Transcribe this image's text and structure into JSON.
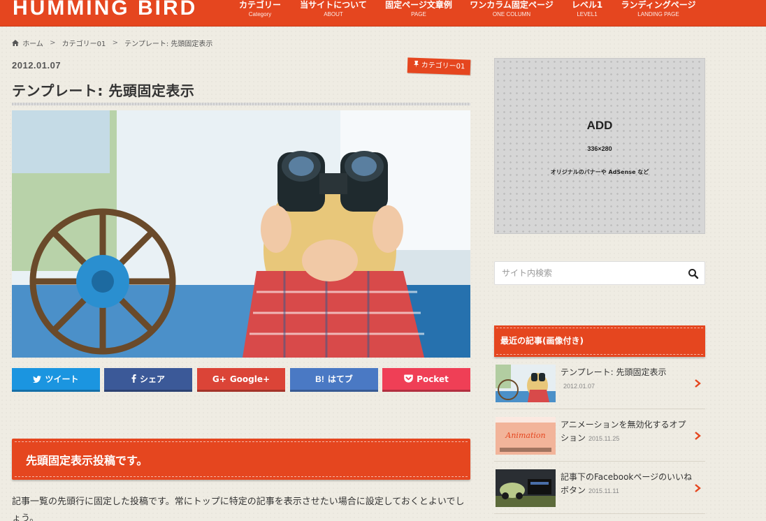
{
  "header": {
    "logo": "HUMMING BIRD",
    "nav": [
      {
        "jp": "カテゴリー",
        "en": "Category"
      },
      {
        "jp": "当サイトについて",
        "en": "ABOUT"
      },
      {
        "jp": "固定ページ文章例",
        "en": "PAGE"
      },
      {
        "jp": "ワンカラム固定ページ",
        "en": "ONE COLUMN"
      },
      {
        "jp": "レベル1",
        "en": "LEVEL1"
      },
      {
        "jp": "ランディングページ",
        "en": "LANDING PAGE"
      }
    ]
  },
  "breadcrumb": {
    "home": "ホーム",
    "sep": ">",
    "category": "カテゴリー01",
    "current": "テンプレート: 先頭固定表示"
  },
  "post": {
    "date": "2012.01.07",
    "category": "カテゴリー01",
    "title": "テンプレート: 先頭固定表示",
    "heading": "先頭固定表示投稿です。",
    "body": "記事一覧の先頭行に固定した投稿です。常にトップに特定の記事を表示させたい場合に設定しておくとよいでしょう。"
  },
  "share": [
    {
      "label": "ツイート",
      "color": "#1b95e0"
    },
    {
      "label": "シェア",
      "color": "#3b5998"
    },
    {
      "label": "Google+",
      "color": "#db4437"
    },
    {
      "label": "はてブ",
      "color": "#4a79c4"
    },
    {
      "label": "Pocket",
      "color": "#ef3f56"
    }
  ],
  "sidebar": {
    "ad": {
      "title": "ADD",
      "size": "336×280",
      "note": "オリジナルのバナーや AdSense など"
    },
    "search_placeholder": "サイト内検索",
    "recent_heading": "最近の記事(画像付き)",
    "recent": [
      {
        "title": "テンプレート: 先頭固定表示",
        "date": "2012.01.07"
      },
      {
        "title": "アニメーションを無効化するオプション",
        "date": "2015.11.25"
      },
      {
        "title": "記事下のFacebookページのいいねボタン",
        "date": "2015.11.11"
      }
    ]
  },
  "colors": {
    "brand": "#e5461f",
    "background": "#efece3"
  }
}
